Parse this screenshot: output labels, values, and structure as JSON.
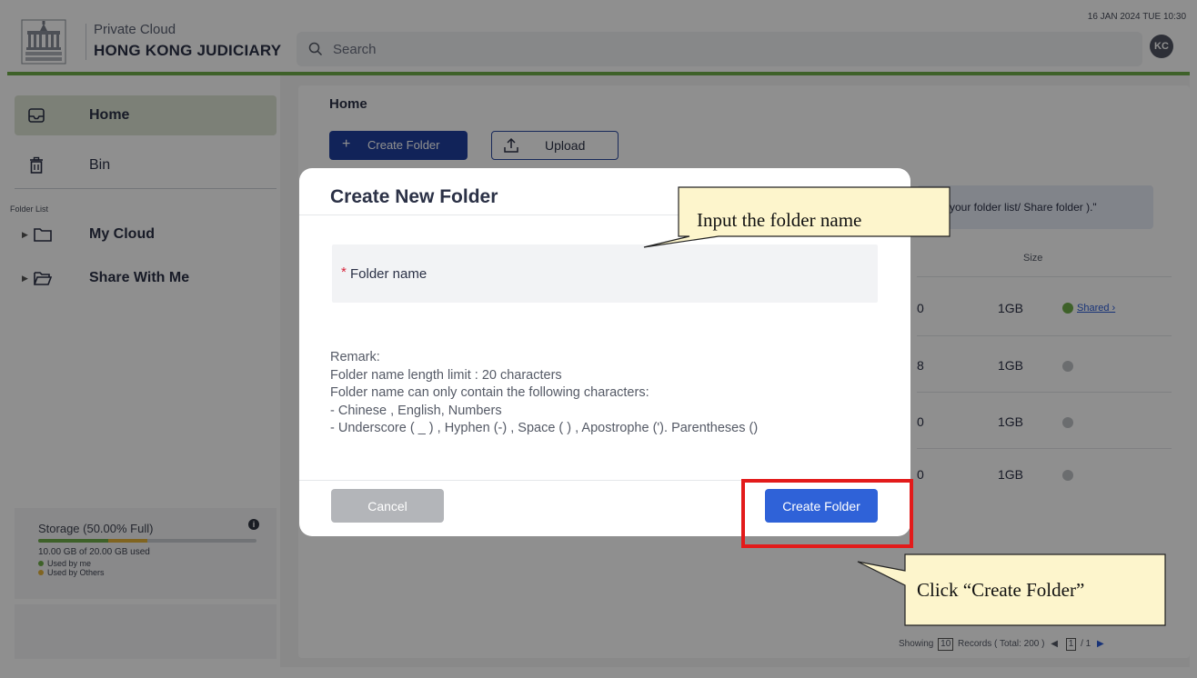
{
  "header": {
    "brand_line1": "Private Cloud",
    "brand_line2": "HONG KONG JUDICIARY",
    "search_placeholder": "Search",
    "datetime": "16 JAN 2024 TUE 10:30",
    "avatar_initials": "KC",
    "accent_color": "#6fae4a"
  },
  "sidebar": {
    "nav": [
      {
        "label": "Home",
        "icon": "inbox-icon",
        "active": true
      },
      {
        "label": "Bin",
        "icon": "trash-icon",
        "active": false
      }
    ],
    "folder_list_title": "Folder List",
    "folders": [
      {
        "label": "My Cloud",
        "icon": "folder-icon"
      },
      {
        "label": "Share With Me",
        "icon": "folder-open-icon"
      }
    ],
    "storage": {
      "title": "Storage (50.00% Full)",
      "used_text": "10.00 GB of 20.00 GB used",
      "legend_me": "Used by me",
      "legend_others": "Used by Others",
      "fraction_me": 0.32,
      "fraction_others": 0.18,
      "color_me": "#6fae4a",
      "color_others": "#e4b23a"
    }
  },
  "main": {
    "title": "Home",
    "create_folder_label": "Create Folder",
    "upload_label": "Upload",
    "notice_text": "your folder list/ Share folder ).\"",
    "size_header": "Size",
    "rows": [
      {
        "num": "0",
        "size": "1GB",
        "shared": true,
        "shared_label": "Shared ›"
      },
      {
        "num": "8",
        "size": "1GB",
        "shared": false
      },
      {
        "num": "0",
        "size": "1GB",
        "shared": false
      },
      {
        "num": "0",
        "size": "1GB",
        "shared": false
      }
    ],
    "pager": {
      "showing": "Showing",
      "per_page": "10",
      "records": "Records ( Total: 200 )",
      "page": "1",
      "of_pages": "/ 1"
    }
  },
  "modal": {
    "title": "Create New Folder",
    "field_required_mark": "*",
    "field_placeholder": "Folder name",
    "remarks": [
      "Remark:",
      "Folder name length limit : 20 characters",
      "Folder name can only contain the following characters:",
      "- Chinese , English, Numbers",
      "- Underscore ( _ ) , Hyphen (-) , Space ( ) , Apostrophe ('). Parentheses ()"
    ],
    "cancel_label": "Cancel",
    "create_label": "Create Folder"
  },
  "annotations": {
    "input_hint": "Input the folder name",
    "click_hint": "Click “Create Folder”",
    "highlight_color": "#e31b1b",
    "callout_fill": "#fdf5cc"
  }
}
